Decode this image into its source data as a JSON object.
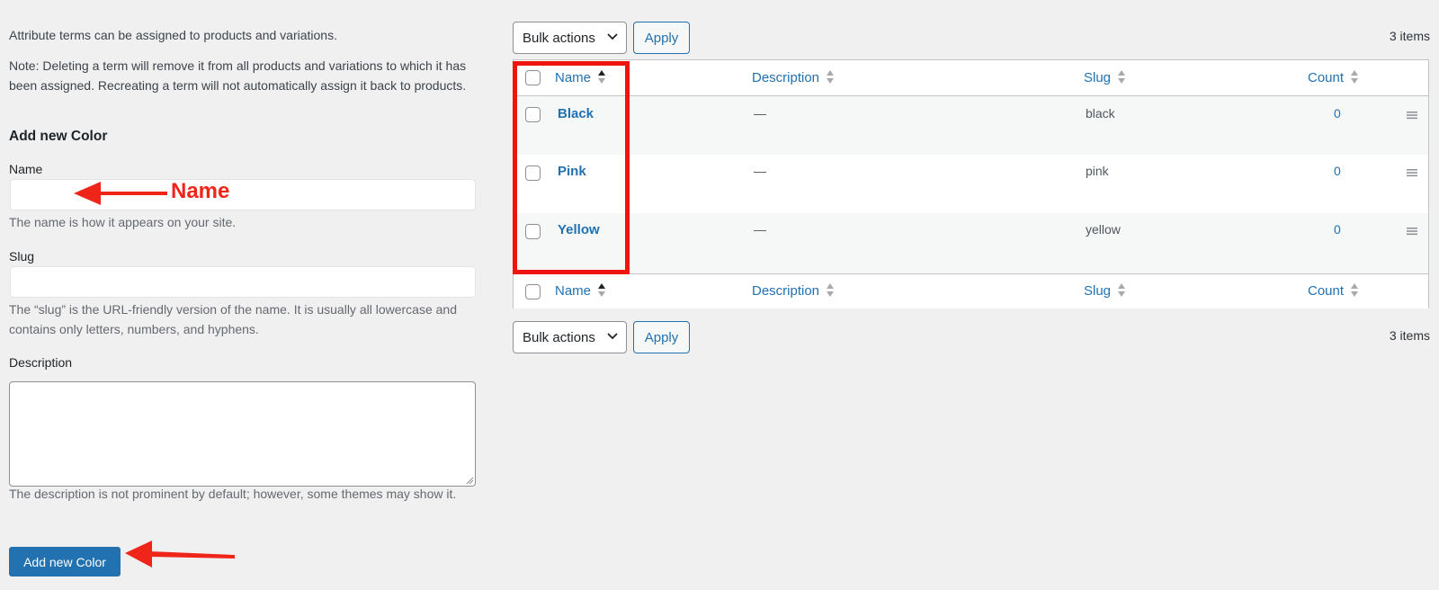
{
  "intro_text": "Attribute terms can be assigned to products and variations.",
  "note_text": "Note: Deleting a term will remove it from all products and variations to which it has been assigned. Recreating a term will not automatically assign it back to products.",
  "form": {
    "title": "Add new Color",
    "name": {
      "label": "Name",
      "value": "",
      "placeholder": "",
      "help": "The name is how it appears on your site."
    },
    "slug": {
      "label": "Slug",
      "value": "",
      "placeholder": "",
      "help": "The “slug” is the URL-friendly version of the name. It is usually all lowercase and contains only letters, numbers, and hyphens."
    },
    "description": {
      "label": "Description",
      "value": "",
      "help": "The description is not prominent by default; however, some themes may show it."
    },
    "submit_label": "Add new Color"
  },
  "annotations": {
    "name_arrow_label": "Name",
    "color": "#f0251a"
  },
  "tablenav_top": {
    "bulk_actions": "Bulk actions",
    "apply": "Apply",
    "items_count": "3 items"
  },
  "tablenav_bottom": {
    "bulk_actions": "Bulk actions",
    "apply": "Apply",
    "items_count": "3 items"
  },
  "table": {
    "columns": [
      {
        "label": "Name",
        "sorted": "asc"
      },
      {
        "label": "Description",
        "sorted": "none"
      },
      {
        "label": "Slug",
        "sorted": "none"
      },
      {
        "label": "Count",
        "sorted": "none"
      }
    ],
    "rows": [
      {
        "name": "Black",
        "description": "—",
        "slug": "black",
        "count": "0"
      },
      {
        "name": "Pink",
        "description": "—",
        "slug": "pink",
        "count": "0"
      },
      {
        "name": "Yellow",
        "description": "—",
        "slug": "yellow",
        "count": "0"
      }
    ]
  },
  "colors": {
    "accent": "#2271b1",
    "background": "#f0f0f1",
    "highlight": "#f0140f"
  }
}
